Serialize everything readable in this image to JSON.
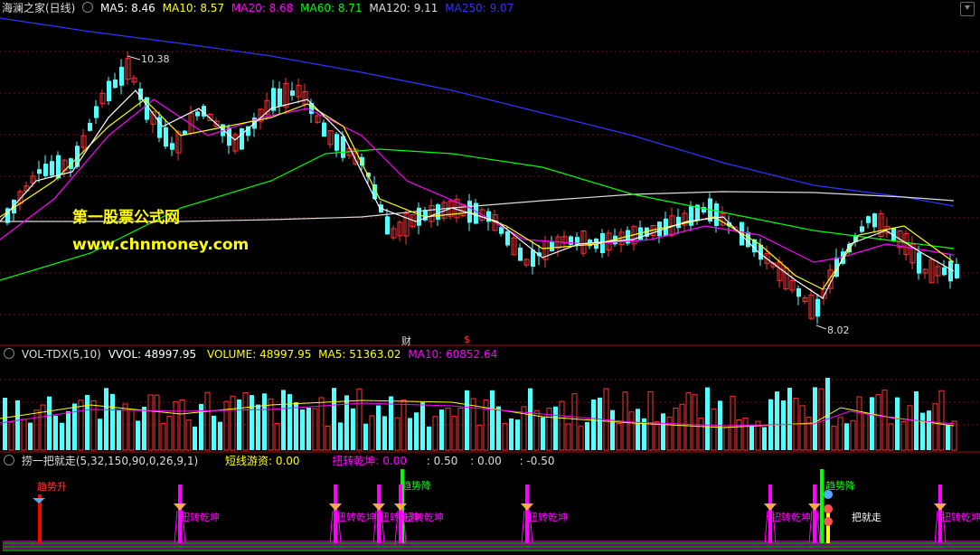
{
  "main": {
    "title": "海澜之家(日线)",
    "ma": [
      {
        "label": "MA5: 8.46",
        "color": "#ffffff"
      },
      {
        "label": "MA10: 8.57",
        "color": "#ffff00"
      },
      {
        "label": "MA20: 8.68",
        "color": "#ff00ff"
      },
      {
        "label": "MA60: 8.71",
        "color": "#00ff00"
      },
      {
        "label": "MA120: 9.11",
        "color": "#dddddd"
      },
      {
        "label": "MA250: 9.07",
        "color": "#3333ff"
      }
    ],
    "high_label": "10.38",
    "low_label": "8.02",
    "marker_cai": "财",
    "marker_s": "$",
    "watermark_1": "第一股票公式网",
    "watermark_2": "www.chnmoney.com"
  },
  "volume": {
    "title": "VOL-TDX(5,10)",
    "vvol": "VVOL: 48997.95",
    "volume": "VOLUME: 48997.95",
    "ma5": "MA5: 51363.02",
    "ma10": "MA10: 60852.64"
  },
  "indicator": {
    "title": "捞一把就走(5,32,150,90,0,26,9,1)",
    "short": "短线游资: 0.00",
    "twist": "扭转乾坤: 0.00",
    "v1": ": 0.50",
    "v2": ": 0.00",
    "v3": ": -0.50",
    "sig_up": "趋势升",
    "sig_down": "趋势降",
    "sig_twist": "扭转乾坤",
    "sig_go": "把就走"
  }
}
